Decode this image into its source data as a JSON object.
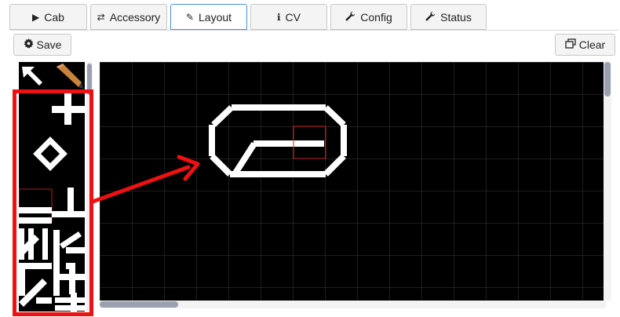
{
  "tabs": [
    {
      "label": "Cab",
      "icon": "play-icon",
      "glyph": "▶",
      "active": false
    },
    {
      "label": "Accessory",
      "icon": "shuffle-icon",
      "glyph": "⇄",
      "active": false
    },
    {
      "label": "Layout",
      "icon": "pencil-icon",
      "glyph": "✎",
      "active": true
    },
    {
      "label": "CV",
      "icon": "info-icon",
      "glyph": "ℹ",
      "active": false
    },
    {
      "label": "Config",
      "icon": "wrench-icon",
      "glyph": "🔧",
      "active": false
    },
    {
      "label": "Status",
      "icon": "wrench-icon",
      "glyph": "🔧",
      "active": false
    }
  ],
  "toolbar": {
    "save_label": "Save",
    "save_icon": "gear-icon",
    "clear_label": "Clear",
    "clear_icon": "window-restore-icon"
  },
  "palette": {
    "tools": [
      "pointer-arrow-icon",
      "pencil-icon"
    ],
    "track_pieces": [
      "track-cross",
      "track-diamond",
      "track-end",
      "track-straight",
      "track-curve",
      "track-switch"
    ]
  },
  "annotation": {
    "highlight_color": "#ee1111"
  },
  "colors": {
    "grid_background": "#000000",
    "grid_lines": "#3a3a3a",
    "track": "#ffffff",
    "selection": "#cc2222",
    "active_tab_border": "#4a90d9"
  }
}
